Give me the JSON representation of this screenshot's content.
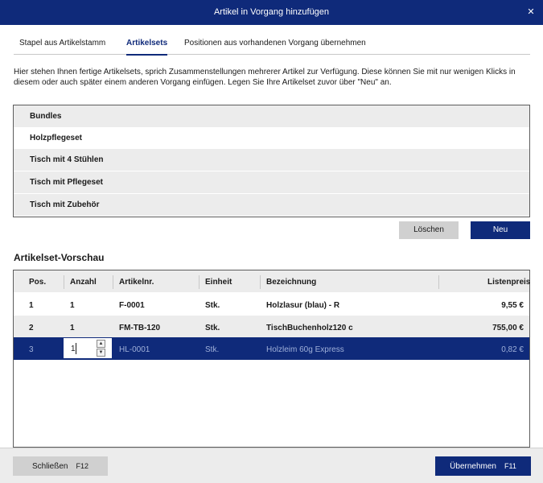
{
  "window": {
    "title": "Artikel in Vorgang hinzufügen",
    "close_glyph": "✕"
  },
  "tabs": [
    {
      "label": "Stapel aus Artikelstamm"
    },
    {
      "label": "Artikelsets"
    },
    {
      "label": "Positionen aus vorhandenen Vorgang übernehmen"
    }
  ],
  "active_tab": "Artikelsets",
  "description": "Hier stehen Ihnen fertige Artikelsets, sprich Zusammenstellungen mehrerer Artikel zur Verfügung. Diese können Sie mit nur wenigen Klicks in diesem oder auch später einem anderen Vorgang einfügen. Legen Sie Ihre Artikelset zuvor über \"Neu\" an.",
  "article_sets": [
    "Bundles",
    "Holzpflegeset",
    "Tisch mit 4 Stühlen",
    "Tisch mit Pflegeset",
    "Tisch mit Zubehör"
  ],
  "buttons": {
    "delete": "Löschen",
    "new": "Neu"
  },
  "preview": {
    "title": "Artikelset-Vorschau",
    "columns": [
      "Pos.",
      "Anzahl",
      "Artikelnr.",
      "Einheit",
      "Bezeichnung",
      "Listenpreis"
    ],
    "rows": [
      {
        "pos": "1",
        "qty": "1",
        "artnr": "F-0001",
        "unit": "Stk.",
        "name": "Holzlasur (blau) - R",
        "price": "9,55 €"
      },
      {
        "pos": "2",
        "qty": "1",
        "artnr": "FM-TB-120",
        "unit": "Stk.",
        "name": "TischBuchenholz120 c",
        "price": "755,00 €"
      },
      {
        "pos": "3",
        "qty": "1",
        "artnr": "HL-0001",
        "unit": "Stk.",
        "name": "Holzleim 60g Express",
        "price": "0,82 €"
      }
    ],
    "selected_row": 3
  },
  "footer": {
    "close_label": "Schließen",
    "close_key": "F12",
    "apply_label": "Übernehmen",
    "apply_key": "F11"
  },
  "colors": {
    "accent": "#0f2a7a",
    "row_alt": "#ececec",
    "button_grey": "#d0d0d0"
  },
  "icons": {
    "close": "close-icon",
    "spin_up": "spin-up-icon",
    "spin_down": "spin-down-icon"
  }
}
